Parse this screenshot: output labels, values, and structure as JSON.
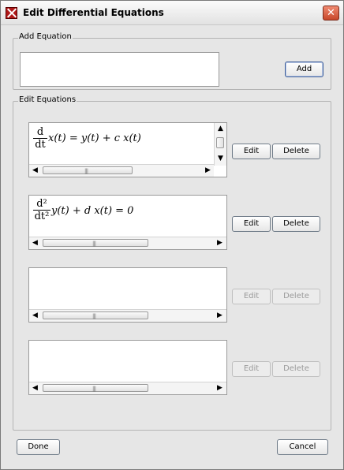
{
  "window": {
    "title": "Edit Differential Equations",
    "close_glyph": "✕",
    "icon": "app-icon"
  },
  "add_group": {
    "legend": "Add Equation",
    "input_value": "",
    "add_label": "Add"
  },
  "edit_group": {
    "legend": "Edit Equations",
    "rows": [
      {
        "frac_num": "d",
        "frac_den": "dt",
        "rest": "x(t) = y(t) + c x(t)",
        "edit_label": "Edit",
        "delete_label": "Delete",
        "enabled": true
      },
      {
        "frac_num": "d²",
        "frac_den": "dt²",
        "rest": "y(t) + d x(t) = 0",
        "edit_label": "Edit",
        "delete_label": "Delete",
        "enabled": true
      },
      {
        "frac_num": "",
        "frac_den": "",
        "rest": "",
        "edit_label": "Edit",
        "delete_label": "Delete",
        "enabled": false
      },
      {
        "frac_num": "",
        "frac_den": "",
        "rest": "",
        "edit_label": "Edit",
        "delete_label": "Delete",
        "enabled": false
      }
    ]
  },
  "footer": {
    "done_label": "Done",
    "cancel_label": "Cancel"
  },
  "glyphs": {
    "left": "◀",
    "right": "▶",
    "up": "▲",
    "down": "▼",
    "grip": "|||",
    "vgrip": "≡"
  }
}
